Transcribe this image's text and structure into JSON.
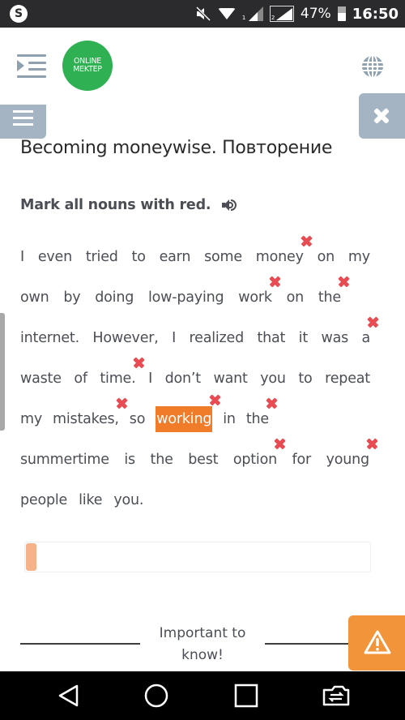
{
  "status_bar": {
    "app_icon": "shazam-icon",
    "icons": [
      "mute-icon",
      "wifi-icon",
      "signal-sim1-icon",
      "signal-sim2-icon",
      "battery-icon"
    ],
    "sim1_label": "1",
    "sim2_label": "2",
    "battery": "47%",
    "time": "16:50"
  },
  "header": {
    "menu_icon": "indent-menu-icon",
    "logo_line1": "ONLINE",
    "logo_line2": "MEKTEP",
    "globe_icon": "globe-icon"
  },
  "controls": {
    "sidebar_toggle_icon": "hamburger-icon",
    "close_icon": "close-icon"
  },
  "lesson": {
    "title": "Becoming moneywise. Повторение",
    "instruction": "Mark all nouns with red.",
    "audio_icon": "speaker-icon"
  },
  "passage": {
    "lines": [
      [
        {
          "t": "I"
        },
        {
          "t": "even"
        },
        {
          "t": "tried"
        },
        {
          "t": "to"
        },
        {
          "t": "earn"
        },
        {
          "t": "some"
        },
        {
          "t": "money",
          "m": true
        },
        {
          "t": "on"
        },
        {
          "t": "my"
        }
      ],
      [
        {
          "t": "own"
        },
        {
          "t": "by"
        },
        {
          "t": "doing"
        },
        {
          "t": "low-paying"
        },
        {
          "t": "work",
          "m": true
        },
        {
          "t": "on"
        },
        {
          "t": "the",
          "m": true
        }
      ],
      [
        {
          "t": "internet."
        },
        {
          "t": "However,"
        },
        {
          "t": "I"
        },
        {
          "t": "realized"
        },
        {
          "t": "that"
        },
        {
          "t": "it"
        },
        {
          "t": "was"
        },
        {
          "t": "a",
          "m": true
        }
      ],
      [
        {
          "t": "waste"
        },
        {
          "t": "of"
        },
        {
          "t": "time.",
          "m": true
        },
        {
          "t": "I"
        },
        {
          "t": "don’t"
        },
        {
          "t": "want"
        },
        {
          "t": "you"
        },
        {
          "t": "to"
        },
        {
          "t": "repeat"
        }
      ],
      [
        {
          "t": "my"
        },
        {
          "t": "mistakes,",
          "m": true
        },
        {
          "t": "so"
        },
        {
          "t": "working",
          "m": true,
          "s": true
        },
        {
          "t": "in"
        },
        {
          "t": "the",
          "m": true
        }
      ],
      [
        {
          "t": "summertime"
        },
        {
          "t": "is"
        },
        {
          "t": "the"
        },
        {
          "t": "best"
        },
        {
          "t": "option",
          "m": true
        },
        {
          "t": "for"
        },
        {
          "t": "young",
          "m": true
        }
      ],
      [
        {
          "t": "people"
        },
        {
          "t": "like"
        },
        {
          "t": "you."
        }
      ]
    ],
    "selected_color": "#f07c2a",
    "mark_color": "#e84c52"
  },
  "progress": {
    "value_percent": 3
  },
  "footer": {
    "important_label": "Important to know!",
    "warning_icon": "warning-icon"
  },
  "nav_bar": {
    "buttons": [
      "back-icon",
      "home-icon",
      "recents-icon",
      "switch-app-icon"
    ]
  }
}
